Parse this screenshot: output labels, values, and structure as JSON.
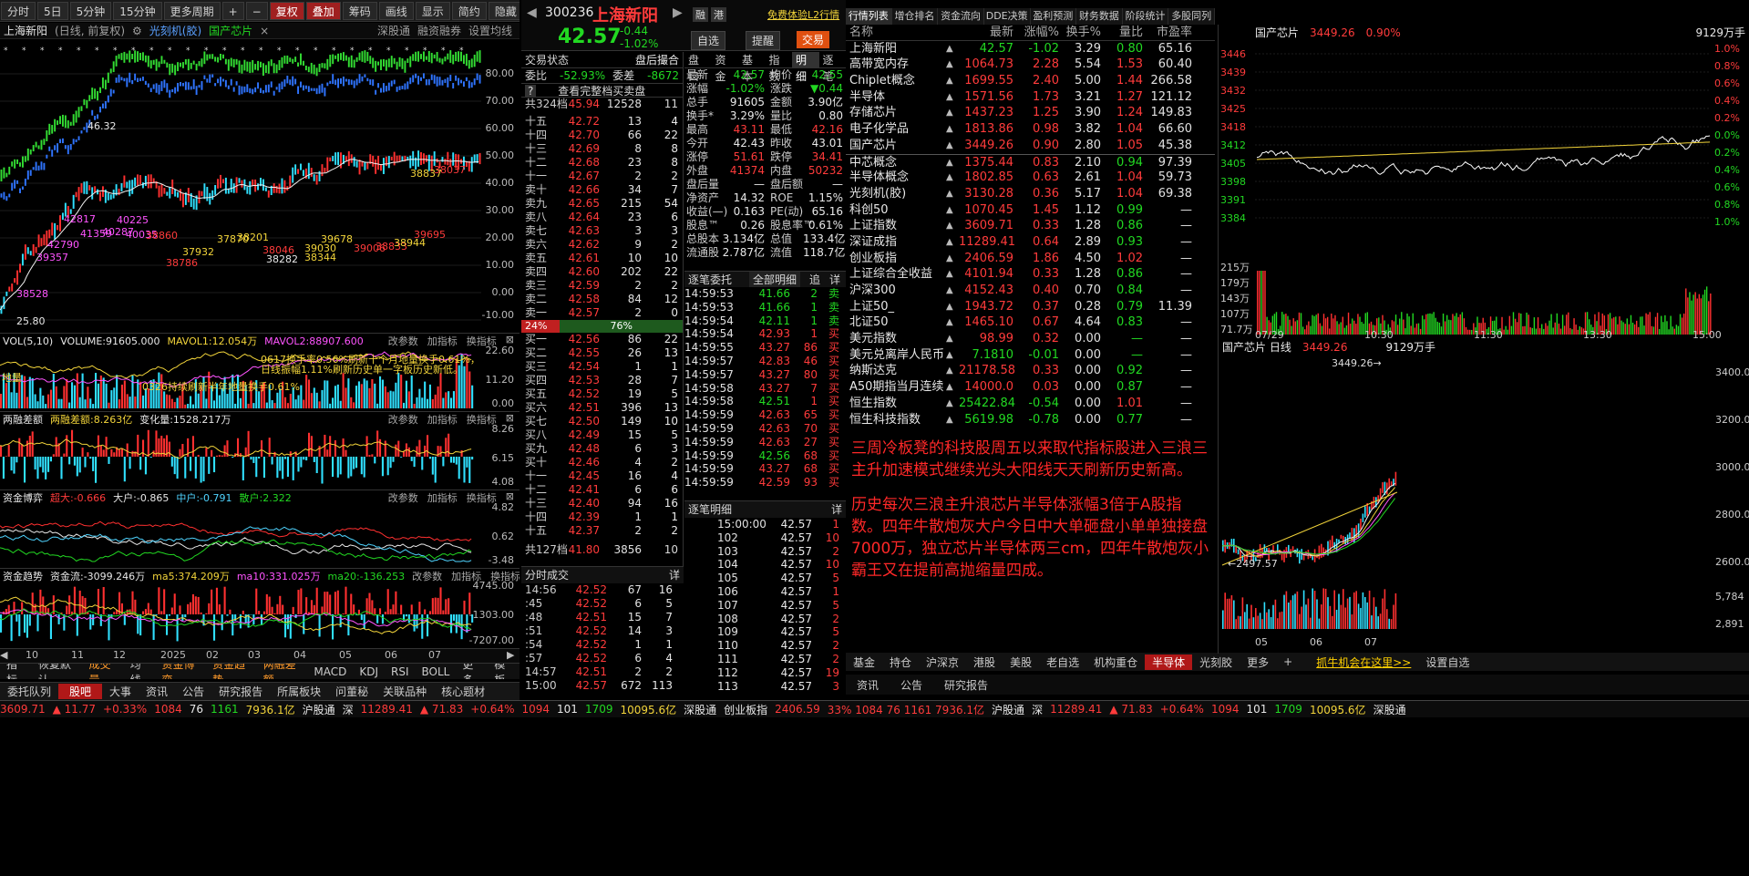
{
  "toolbar": {
    "items": [
      "分时",
      "5日",
      "5分钟",
      "15分钟",
      "更多周期",
      "+",
      "−",
      "复权",
      "叠加",
      "筹码",
      "画线",
      "显示",
      "简约",
      "隐藏"
    ]
  },
  "chart_header": {
    "stock": "上海新阳",
    "mode": "(日线, 前复权)",
    "overlay1": "光刻机(胶)",
    "overlay2": "国产芯片",
    "links": [
      "深股通",
      "融资融券",
      "设置均线"
    ]
  },
  "main_axis": [
    "80.00",
    "70.00",
    "60.00",
    "50.00",
    "40.00",
    "30.00",
    "20.00",
    "10.00",
    "0.00",
    "-10.00"
  ],
  "main_labels": {
    "hi": "46.32",
    "lo": "25.80",
    "l38528": "38528",
    "l39357": "39357",
    "l42790": "42790",
    "l42817": "42817",
    "l40225": "40225",
    "l41359": "41359",
    "l40287": "40287",
    "l40035": "40035",
    "l38860": "38860",
    "l38786": "38786",
    "l37932": "37932",
    "l37870": "37870",
    "l38201": "38201",
    "l38046": "38046",
    "l38282": "38282",
    "l39030": "39030",
    "l38344": "38344",
    "l39678": "39678",
    "l39006": "39006",
    "l38833": "38833",
    "l38944": "38944",
    "l38837": "38837",
    "l38037": "38037",
    "l39695": "39695",
    "l39664": "39664",
    "l39558": "39558"
  },
  "vol": {
    "title": "VOL(5,10)",
    "v1": "VOLUME:91605.000",
    "v2": "MAVOL1:12.054万",
    "v3": "MAVOL2:88907.600",
    "ax": [
      "22.60",
      "11.20",
      "0.00"
    ],
    "note1": "0617换手率0.56%刷新十个月地量换手0.61%，",
    "note2": "日线振幅1.11%刷新历史单一字板历史新低。",
    "note3": "0326持续刷新半年地量换手0.61%",
    "note4": "地量",
    "links": [
      "改参数",
      "加指标",
      "换指标"
    ]
  },
  "rz": {
    "title": "两融差额",
    "v1": "两融差额:8.263亿",
    "v2": "变化量:1528.217万",
    "ax": [
      "8.26",
      "6.15",
      "4.08"
    ]
  },
  "zj": {
    "title": "资金博弈",
    "v1": "超大:-0.666",
    "v2": "大户:-0.865",
    "v3": "中户:-0.791",
    "v4": "散户:2.322",
    "ax": [
      "4.82",
      "0.62",
      "-3.48"
    ]
  },
  "zq": {
    "title": "资金趋势",
    "v1": "资金流:-3099.246万",
    "v2": "ma5:374.209万",
    "v3": "ma10:331.025万",
    "v4": "ma20:-136.253",
    "ax": [
      "4745.00",
      "-1303.00",
      "-7207.00"
    ]
  },
  "date_axis": [
    "10",
    "11",
    "12",
    "2025",
    "02",
    "03",
    "04",
    "05",
    "06",
    "07"
  ],
  "tabs1": [
    "指标",
    "恢复默认",
    "成交量",
    "均线",
    "资金博弈",
    "资金趋势",
    "两融差额",
    "MACD",
    "KDJ",
    "RSI",
    "BOLL",
    "更多",
    "模板"
  ],
  "tabs2": [
    "委托队列",
    "股吧",
    "大事",
    "资讯",
    "公告",
    "研究报告",
    "所属板块",
    "问董秘",
    "关联品种",
    "核心题材"
  ],
  "stock": {
    "code": "300236",
    "name": "上海新阳",
    "price": "42.57",
    "chg": "-0.44",
    "pct": "-1.02%",
    "l2": "免费体验L2行情",
    "btn1": "自选",
    "btn2": "提醒",
    "btn3": "交易"
  },
  "ob": {
    "state": "交易状态",
    "state_v": "盘后撮合",
    "wb": "委比",
    "wb_v": "-52.93%",
    "wc": "委差",
    "wc_v": "-8672",
    "full": "查看完整档买卖盘",
    "sell_sum": [
      "共324档",
      "45.94",
      "12528",
      "11"
    ],
    "buy_sum": [
      "共127档",
      "41.80",
      "3856",
      "10"
    ],
    "bar": [
      "24%",
      "76%"
    ],
    "sells": [
      [
        "十五",
        "42.72",
        "13",
        "4"
      ],
      [
        "十四",
        "42.70",
        "66",
        "22"
      ],
      [
        "十三",
        "42.69",
        "8",
        "8"
      ],
      [
        "十二",
        "42.68",
        "23",
        "8"
      ],
      [
        "十一",
        "42.67",
        "2",
        "2"
      ],
      [
        "卖十",
        "42.66",
        "34",
        "7"
      ],
      [
        "卖九",
        "42.65",
        "215",
        "54"
      ],
      [
        "卖八",
        "42.64",
        "23",
        "6"
      ],
      [
        "卖七",
        "42.63",
        "3",
        "3"
      ],
      [
        "卖六",
        "42.62",
        "9",
        "2"
      ],
      [
        "卖五",
        "42.61",
        "10",
        "10"
      ],
      [
        "卖四",
        "42.60",
        "202",
        "22"
      ],
      [
        "卖三",
        "42.59",
        "2",
        "2"
      ],
      [
        "卖二",
        "42.58",
        "84",
        "12"
      ],
      [
        "卖一",
        "42.57",
        "2",
        "0"
      ]
    ],
    "buys": [
      [
        "买一",
        "42.56",
        "86",
        "22"
      ],
      [
        "买二",
        "42.55",
        "26",
        "13"
      ],
      [
        "买三",
        "42.54",
        "1",
        "1"
      ],
      [
        "买四",
        "42.53",
        "28",
        "7"
      ],
      [
        "买五",
        "42.52",
        "19",
        "5"
      ],
      [
        "买六",
        "42.51",
        "396",
        "13"
      ],
      [
        "买七",
        "42.50",
        "149",
        "10"
      ],
      [
        "买八",
        "42.49",
        "15",
        "5"
      ],
      [
        "买九",
        "42.48",
        "6",
        "3"
      ],
      [
        "买十",
        "42.46",
        "4",
        "2"
      ],
      [
        "十一",
        "42.45",
        "16",
        "4"
      ],
      [
        "十二",
        "42.41",
        "6",
        "6"
      ],
      [
        "十三",
        "42.40",
        "94",
        "16"
      ],
      [
        "十四",
        "42.39",
        "1",
        "1"
      ],
      [
        "十五",
        "42.37",
        "2",
        "2"
      ]
    ]
  },
  "qp_tabs": [
    "盘口",
    "资金",
    "基本",
    "指数",
    "明细",
    "逐笔"
  ],
  "quote": [
    [
      "最新",
      "42.57",
      "均价",
      "42.55"
    ],
    [
      "涨幅",
      "-1.02%",
      "涨跌",
      "▼0.44"
    ],
    [
      "总手",
      "91605",
      "金额",
      "3.90亿"
    ],
    [
      "换手*",
      "3.29%",
      "量比",
      "0.80"
    ],
    [
      "最高",
      "43.11",
      "最低",
      "42.16"
    ],
    [
      "今开",
      "42.43",
      "昨收",
      "43.01"
    ],
    [
      "涨停",
      "51.61",
      "跌停",
      "34.41"
    ],
    [
      "外盘",
      "41374",
      "内盘",
      "50232"
    ],
    [
      "盘后量",
      "—",
      "盘后额",
      "—"
    ],
    [
      "净资产",
      "14.32",
      "ROE",
      "1.15%"
    ],
    [
      "收益(—)",
      "0.163",
      "PE(动)",
      "65.16"
    ],
    [
      "股息™",
      "0.26",
      "股息率™",
      "0.61%"
    ],
    [
      "总股本",
      "3.134亿",
      "总值",
      "133.4亿"
    ],
    [
      "流通股",
      "2.787亿",
      "流值",
      "118.7亿"
    ]
  ],
  "tick": {
    "title": "逐笔委托",
    "sel": "全部明细",
    "b1": "追",
    "b2": "详",
    "rows": [
      [
        "14:59:53",
        "41.66",
        "2",
        "卖"
      ],
      [
        "14:59:53",
        "41.66",
        "1",
        "卖"
      ],
      [
        "14:59:54",
        "42.11",
        "1",
        "卖"
      ],
      [
        "14:59:54",
        "42.93",
        "1",
        "买"
      ],
      [
        "14:59:55",
        "43.27",
        "86",
        "买"
      ],
      [
        "14:59:57",
        "42.83",
        "46",
        "买"
      ],
      [
        "14:59:57",
        "43.27",
        "80",
        "买"
      ],
      [
        "14:59:58",
        "43.27",
        "7",
        "买"
      ],
      [
        "14:59:58",
        "42.51",
        "1",
        "买"
      ],
      [
        "14:59:59",
        "42.63",
        "65",
        "买"
      ],
      [
        "14:59:59",
        "42.63",
        "70",
        "买"
      ],
      [
        "14:59:59",
        "42.63",
        "27",
        "买"
      ],
      [
        "14:59:59",
        "42.56",
        "68",
        "买"
      ],
      [
        "14:59:59",
        "43.27",
        "68",
        "买"
      ],
      [
        "14:59:59",
        "42.59",
        "93",
        "买"
      ]
    ]
  },
  "deals": {
    "title": "逐笔明细",
    "b": "详",
    "rows": [
      [
        "15:00:00",
        "42.57",
        "1"
      ],
      [
        "102",
        "42.57",
        "10"
      ],
      [
        "103",
        "42.57",
        "2"
      ],
      [
        "104",
        "42.57",
        "10"
      ],
      [
        "105",
        "42.57",
        "5"
      ],
      [
        "106",
        "42.57",
        "1"
      ],
      [
        "107",
        "42.57",
        "5"
      ],
      [
        "108",
        "42.57",
        "2"
      ],
      [
        "109",
        "42.57",
        "5"
      ],
      [
        "110",
        "42.57",
        "2"
      ],
      [
        "111",
        "42.57",
        "2"
      ],
      [
        "112",
        "42.57",
        "19"
      ],
      [
        "113",
        "42.57",
        "3"
      ]
    ]
  },
  "ts": {
    "title": "分时成交",
    "b": "详",
    "rows": [
      [
        "14:56",
        "42.52",
        "67",
        "16"
      ],
      [
        ":45",
        "42.52",
        "6",
        "5"
      ],
      [
        ":48",
        "42.51",
        "15",
        "7"
      ],
      [
        ":51",
        "42.52",
        "14",
        "3"
      ],
      [
        ":54",
        "42.52",
        "1",
        "1"
      ],
      [
        ":57",
        "42.52",
        "6",
        "4"
      ],
      [
        "14:57",
        "42.51",
        "2",
        "2"
      ],
      [
        "15:00",
        "42.57",
        "672",
        "113"
      ]
    ]
  },
  "sec_tabs": [
    "行情列表",
    "增仓排名",
    "资金流向",
    "DDE决策",
    "盈利预测",
    "财务数据",
    "阶段统计",
    "多股同列"
  ],
  "sec_head": [
    "名称",
    "最新",
    "涨幅%",
    "换手%",
    "量比",
    "市盈率"
  ],
  "sectors": [
    [
      "上海新阳",
      "42.57",
      "-1.02",
      "3.29",
      "0.80",
      "65.16"
    ],
    [
      "高带宽内存",
      "1064.73",
      "2.28",
      "5.54",
      "1.53",
      "60.40"
    ],
    [
      "Chiplet概念",
      "1699.55",
      "2.40",
      "5.00",
      "1.44",
      "266.58"
    ],
    [
      "半导体",
      "1571.56",
      "1.73",
      "3.21",
      "1.27",
      "121.12"
    ],
    [
      "存储芯片",
      "1437.23",
      "1.25",
      "3.90",
      "1.24",
      "149.83"
    ],
    [
      "电子化学品",
      "1813.86",
      "0.98",
      "3.82",
      "1.04",
      "66.60"
    ],
    [
      "国产芯片",
      "3449.26",
      "0.90",
      "2.80",
      "1.05",
      "45.38"
    ],
    [
      "中芯概念",
      "1375.44",
      "0.83",
      "2.10",
      "0.94",
      "97.39"
    ],
    [
      "半导体概念",
      "1802.85",
      "0.63",
      "2.61",
      "1.04",
      "59.73"
    ],
    [
      "光刻机(胶)",
      "3130.28",
      "0.36",
      "5.17",
      "1.04",
      "69.38"
    ],
    [
      "科创50",
      "1070.45",
      "1.45",
      "1.12",
      "0.99",
      "—"
    ],
    [
      "上证指数",
      "3609.71",
      "0.33",
      "1.28",
      "0.86",
      "—"
    ],
    [
      "深证成指",
      "11289.41",
      "0.64",
      "2.89",
      "0.93",
      "—"
    ],
    [
      "创业板指",
      "2406.59",
      "1.86",
      "4.50",
      "1.02",
      "—"
    ],
    [
      "上证综合全收益",
      "4101.94",
      "0.33",
      "1.28",
      "0.86",
      "—"
    ],
    [
      "沪深300",
      "4152.43",
      "0.40",
      "0.70",
      "0.84",
      "—"
    ],
    [
      "上证50_",
      "1943.72",
      "0.37",
      "0.28",
      "0.79",
      "11.39"
    ],
    [
      "北证50",
      "1465.10",
      "0.67",
      "4.64",
      "0.83",
      "—"
    ],
    [
      "美元指数",
      "98.99",
      "0.32",
      "0.00",
      "—",
      "—"
    ],
    [
      "美元兑离岸人民币",
      "7.1810",
      "-0.01",
      "0.00",
      "—",
      "—"
    ],
    [
      "纳斯达克",
      "21178.58",
      "0.33",
      "0.00",
      "0.92",
      "—"
    ],
    [
      "A50期指当月连续",
      "14000.0",
      "0.03",
      "0.00",
      "0.87",
      "—"
    ],
    [
      "恒生指数",
      "25422.84",
      "-0.54",
      "0.00",
      "1.01",
      "—"
    ],
    [
      "恒生科技指数",
      "5619.98",
      "-0.78",
      "0.00",
      "0.77",
      "—"
    ]
  ],
  "note": {
    "p1": "三周冷板凳的科技股周五以来取代指标股进入三浪三主升加速模式继续光头大阳线天天刷新历史新高。",
    "p2": "历史每次三浪主升浪芯片半导体涨幅3倍于A股指数。四年牛散炮灰大户今日中大单砸盘小单单独接盘7000万，独立芯片半导体两三cm，四年牛散炮灰小霸王又在提前高抛缩量四成。"
  },
  "sec_btabs": [
    "基金",
    "持仓",
    "沪深京",
    "港股",
    "美股",
    "老自选",
    "机构重仓",
    "半导体",
    "光刻胶",
    "更多",
    "+",
    "抓牛机会在这里>>",
    "设置自选"
  ],
  "sec_btabs2": [
    "资讯",
    "公告",
    "研究报告"
  ],
  "fr": {
    "name": "国产芯片",
    "price": "3449.26",
    "pct": "0.90%",
    "vol": "9129万手",
    "ax": [
      "3446",
      "3439",
      "3432",
      "3425",
      "3418",
      "3412",
      "3405",
      "3398",
      "3391",
      "3384"
    ],
    "axp": [
      "1.0%",
      "0.8%",
      "0.6%",
      "0.4%",
      "0.2%",
      "0.0%",
      "0.2%",
      "0.4%",
      "0.6%",
      "0.8%",
      "1.0%"
    ],
    "vax": [
      "215万",
      "179万",
      "143万",
      "107万",
      "71.7万",
      "35.8万"
    ],
    "times": [
      "07/29",
      "10:30",
      "11:30",
      "13:30",
      "15:00"
    ],
    "kname": "国产芯片 日线",
    "kprice": "3449.26",
    "kvol": "9129万手",
    "khi": "3449.26",
    "klo": "2497.57",
    "kax": [
      "3400.0",
      "3200.0",
      "3000.0",
      "2800.0",
      "2600.0"
    ],
    "kvax": [
      "5,784",
      "2,891"
    ],
    "kdates": [
      "05",
      "06",
      "07"
    ]
  },
  "status": {
    "sh": "3609.71",
    "shc": "▲ 11.77",
    "shp": "+0.33%",
    "s1": "1084",
    "s2": "76",
    "s3": "1161",
    "shv": "7936.1亿",
    "hgt": "沪股通",
    "sz": "深",
    "szv": "11289.41",
    "szc": "▲ 71.83",
    "szp": "+0.64%",
    "z1": "1094",
    "z2": "101",
    "z3": "1709",
    "szvv": "10095.6亿",
    "sgt": "深股通",
    "cyb": "创业板指",
    "cybv": "2406.59",
    "tail": "33% 1084 76 1161 7936.1亿",
    "hgt2": "沪股通",
    "sz2": "深",
    "szv2": "11289.41",
    "szc2": "▲ 71.83",
    "szp2": "+0.64%",
    "z4": "1094",
    "z5": "101",
    "z6": "1709",
    "szvv2": "10095.6亿",
    "sgt2": "深股通"
  }
}
